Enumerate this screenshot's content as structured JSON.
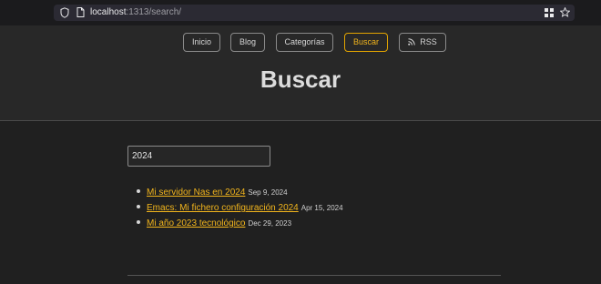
{
  "browser": {
    "url_host": "localhost",
    "url_rest": ":1313/search/"
  },
  "nav": {
    "items": [
      {
        "label": "Inicio"
      },
      {
        "label": "Blog"
      },
      {
        "label": "Categorías"
      },
      {
        "label": "Buscar",
        "active": true
      },
      {
        "label": "RSS"
      }
    ]
  },
  "page": {
    "title": "Buscar"
  },
  "search": {
    "value": "2024"
  },
  "results": [
    {
      "title": "Mi servidor Nas en 2024",
      "date": "Sep 9, 2024"
    },
    {
      "title": "Emacs: Mi fichero configuración 2024",
      "date": "Apr 15, 2024"
    },
    {
      "title": "Mi año 2023 tecnológico",
      "date": "Dec 29, 2023"
    }
  ],
  "colors": {
    "accent": "#f2b51c",
    "background": "#202020",
    "header": "#282828"
  }
}
